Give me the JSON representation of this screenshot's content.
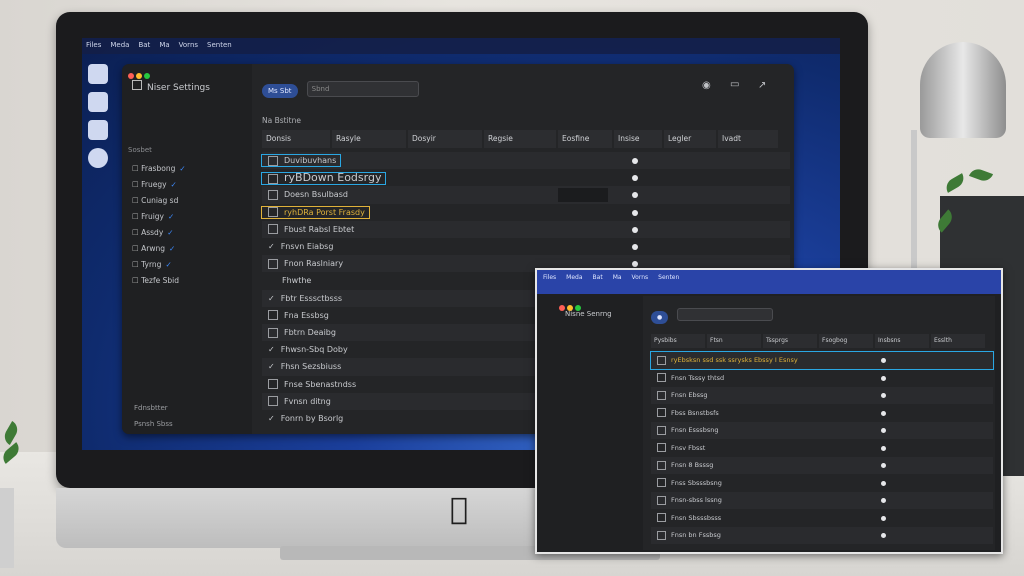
{
  "menubar": [
    "Files",
    "Meda",
    "Bat",
    "Ma",
    "Vorns",
    "Senten"
  ],
  "window": {
    "sidebar_title": "Niser Settings",
    "sidebar_heading": "Sosbet",
    "sidebar_items": [
      {
        "label": "Frasbong",
        "checked": true
      },
      {
        "label": "Fruegy",
        "checked": true
      },
      {
        "label": "Cuniag sd",
        "checked": false
      },
      {
        "label": "Fruigy",
        "checked": true
      },
      {
        "label": "Assdy",
        "checked": true
      },
      {
        "label": "Arwng",
        "checked": true
      },
      {
        "label": "Tyrng",
        "checked": true
      },
      {
        "label": "Tezfe Sbid",
        "checked": false
      }
    ],
    "sidebar_footer": [
      "Fdnsbtter",
      "Psnsh Sbss"
    ],
    "toolbar": {
      "pill": "Ms Sbt",
      "search_placeholder": "Sbnd"
    },
    "section_label": "Na Bstitne",
    "columns": [
      "Donsis",
      "Rasyle",
      "Dosyir",
      "Regsie",
      "Eosfine",
      "Insise",
      "Legler",
      "Ivadt"
    ],
    "rows": [
      {
        "label": "Duvibuvhans",
        "highlight": "blue",
        "mark": "box"
      },
      {
        "label": "ryBDown Eodsrgy",
        "highlight": "blue",
        "mark": "box"
      },
      {
        "label": "Doesn Bsulbasd",
        "highlight": "",
        "mark": "box"
      },
      {
        "label": "ryhDRa Porst Frasdy",
        "highlight": "yellow",
        "mark": "box"
      },
      {
        "label": "Fbust Rabsl Ebtet",
        "highlight": "",
        "mark": "box"
      },
      {
        "label": "Fnsvn Eiabsg",
        "highlight": "",
        "mark": "check"
      },
      {
        "label": "Fnon Raslniary",
        "highlight": "",
        "mark": "box"
      },
      {
        "label": "Fhwthe",
        "highlight": "",
        "mark": "none"
      },
      {
        "label": "Fbtr Esssctbsss",
        "highlight": "",
        "mark": "check"
      },
      {
        "label": "Fna Essbsg",
        "highlight": "",
        "mark": "box"
      },
      {
        "label": "Fbtrn Deaibg",
        "highlight": "",
        "mark": "box"
      },
      {
        "label": "Fhwsn-Sbq Doby",
        "highlight": "",
        "mark": "check"
      },
      {
        "label": "Fhsn Sezsbiuss",
        "highlight": "",
        "mark": "check"
      },
      {
        "label": "Fnse Sbenastndss",
        "highlight": "",
        "mark": "box"
      },
      {
        "label": "Fvnsn ditng",
        "highlight": "",
        "mark": "box"
      },
      {
        "label": "Fonrn by Bsorlg",
        "highlight": "",
        "mark": "check"
      }
    ]
  },
  "inset": {
    "sidebar_title": "Nisne Senrng",
    "columns": [
      "Pysbibs",
      "Ftsn",
      "Tssprgs",
      "Fsogbog",
      "Insbsns",
      "Esslth"
    ],
    "rows": [
      {
        "label": "ryEbsksn ssd ssk ssrysks Ebssy I Esnsy",
        "highlight": "yellow"
      },
      {
        "label": "Fnsn Tsssy thtsd",
        "highlight": ""
      },
      {
        "label": "Fnsn Ebssg",
        "highlight": ""
      },
      {
        "label": "Fbss Bsnstbsfs",
        "highlight": ""
      },
      {
        "label": "Fnsn Esssbsng",
        "highlight": ""
      },
      {
        "label": "Fnsv Fbsst",
        "highlight": ""
      },
      {
        "label": "Fnsn 8 Bsssg",
        "highlight": ""
      },
      {
        "label": "Fnss Sbsssbsng",
        "highlight": ""
      },
      {
        "label": "Fnsn-sbss lssng",
        "highlight": ""
      },
      {
        "label": "Fnsn Sbsssbsss",
        "highlight": ""
      },
      {
        "label": "Fnsn bn Fssbsg",
        "highlight": ""
      }
    ]
  }
}
